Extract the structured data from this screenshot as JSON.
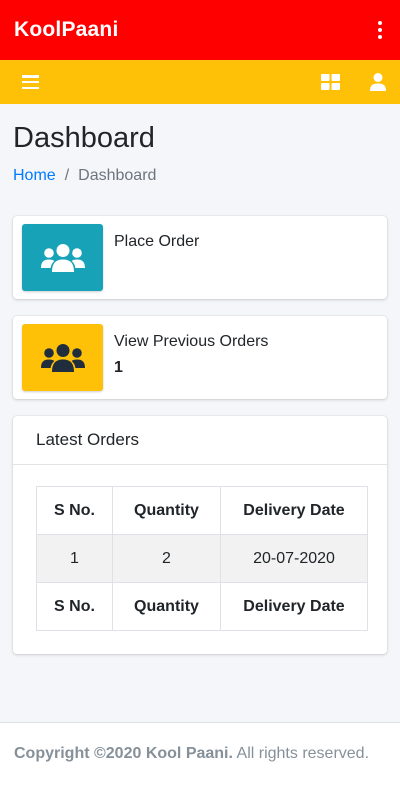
{
  "app": {
    "title": "KoolPaani"
  },
  "nav": {
    "menu_icon": "hamburger-icon",
    "grid_icon": "grid-icon",
    "user_icon": "user-icon"
  },
  "header": {
    "title": "Dashboard",
    "breadcrumb": {
      "home": "Home",
      "separator": "/",
      "current": "Dashboard"
    }
  },
  "info_boxes": [
    {
      "label": "Place Order",
      "number": "",
      "icon": "users-icon",
      "color": "#17a2b8"
    },
    {
      "label": "View Previous Orders",
      "number": "1",
      "icon": "users-icon",
      "color": "#ffc107"
    }
  ],
  "latest_orders": {
    "title": "Latest Orders",
    "columns": [
      "S No.",
      "Quantity",
      "Delivery Date"
    ],
    "rows": [
      [
        "1",
        "2",
        "20-07-2020"
      ]
    ],
    "footer_columns": [
      "S No.",
      "Quantity",
      "Delivery Date"
    ]
  },
  "footer": {
    "copyright": "Copyright ©2020 Kool Paani.",
    "rights": " All rights reserved."
  },
  "colors": {
    "appbar": "#ff0000",
    "navbar": "#ffc107",
    "link": "#007bff",
    "info": "#17a2b8",
    "warning": "#ffc107"
  }
}
